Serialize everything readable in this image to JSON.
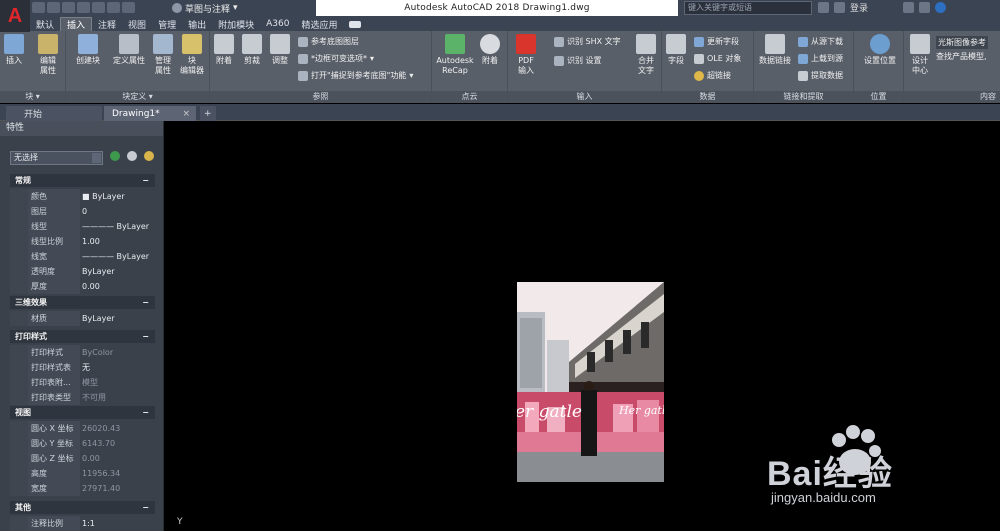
{
  "titlebar": {
    "workspace": "草图与注释",
    "document_title": "Autodesk AutoCAD 2018    Drawing1.dwg",
    "search_placeholder": "键入关键字或短语",
    "login": "登录"
  },
  "ribbon_tabs": [
    "默认",
    "插入",
    "注释",
    "视图",
    "管理",
    "输出",
    "附加模块",
    "A360",
    "精选应用"
  ],
  "ribbon": {
    "block_panel": {
      "title": "块 ▾",
      "insert": "插入",
      "edit_attr": "编辑\n属性"
    },
    "block_def_panel": {
      "title": "块定义 ▾",
      "create": "创建块",
      "define_attr": "定义属性",
      "manage_attr": "管理\n属性",
      "block_editor": "块\n编辑器"
    },
    "reference_panel": {
      "title": "参照",
      "attach": "附着",
      "clip": "剪裁",
      "adjust": "调整",
      "underlay_layers": "参考底图图层",
      "frame_options": "*边框可变选项*",
      "snap_underlay": "打开\"捕捉到参考底图\"功能"
    },
    "pointcloud_panel": {
      "title": "点云",
      "recap": "Autodesk\nReCap",
      "attach": "附着"
    },
    "import_panel": {
      "title": "输入",
      "pdf_import": "PDF\n输入",
      "recognize_shx": "识别 SHX 文字",
      "recognize_settings": "识别 设置",
      "combine_text": "合并\n文字"
    },
    "data_panel": {
      "title": "数据",
      "field": "字段",
      "update_fields": "更新字段",
      "ole_object": "OLE 对象",
      "hyperlink": "超链接"
    },
    "link_panel": {
      "title": "链接和提取",
      "data_link": "数据链接",
      "download_source": "从源下载",
      "upload_source": "上载到源",
      "extract_data": "提取数据"
    },
    "location_panel": {
      "title": "位置",
      "set_location": "设置位置"
    },
    "content_panel": {
      "title": "内容",
      "design_center": "设计\n中心",
      "seek_title": "光斯图像参考",
      "seek_desc": "查找产品模型,"
    }
  },
  "file_tabs": {
    "start": "开始",
    "drawing": "Drawing1*"
  },
  "properties": {
    "title": "特性",
    "selection": "无选择",
    "sections": {
      "general": "常规",
      "three_d": "三维效果",
      "plot_style": "打印样式",
      "view": "视图",
      "misc": "其他"
    },
    "general_rows": [
      {
        "name": "颜色",
        "value": "■ ByLayer"
      },
      {
        "name": "图层",
        "value": "0"
      },
      {
        "name": "线型",
        "value": "———— ByLayer"
      },
      {
        "name": "线型比例",
        "value": "1.00"
      },
      {
        "name": "线宽",
        "value": "———— ByLayer"
      },
      {
        "name": "透明度",
        "value": "ByLayer"
      },
      {
        "name": "厚度",
        "value": "0.00"
      }
    ],
    "three_d_rows": [
      {
        "name": "材质",
        "value": "ByLayer"
      }
    ],
    "plot_rows": [
      {
        "name": "打印样式",
        "value": "ByColor"
      },
      {
        "name": "打印样式表",
        "value": "无"
      },
      {
        "name": "打印表附...",
        "value": "模型"
      },
      {
        "name": "打印表类型",
        "value": "不可用"
      }
    ],
    "view_rows": [
      {
        "name": "圆心 X 坐标",
        "value": "26020.43"
      },
      {
        "name": "圆心 Y 坐标",
        "value": "6143.70"
      },
      {
        "name": "圆心 Z 坐标",
        "value": "0.00"
      },
      {
        "name": "高度",
        "value": "11956.34"
      },
      {
        "name": "宽度",
        "value": "27971.40"
      }
    ],
    "misc_rows": [
      {
        "name": "注释比例",
        "value": "1:1"
      }
    ]
  },
  "image_text": {
    "left": "er gatle",
    "right": "Her gatle"
  },
  "watermark": {
    "brand": "Bai经验",
    "url": "jingyan.baidu.com"
  },
  "ucs_label": "Y"
}
